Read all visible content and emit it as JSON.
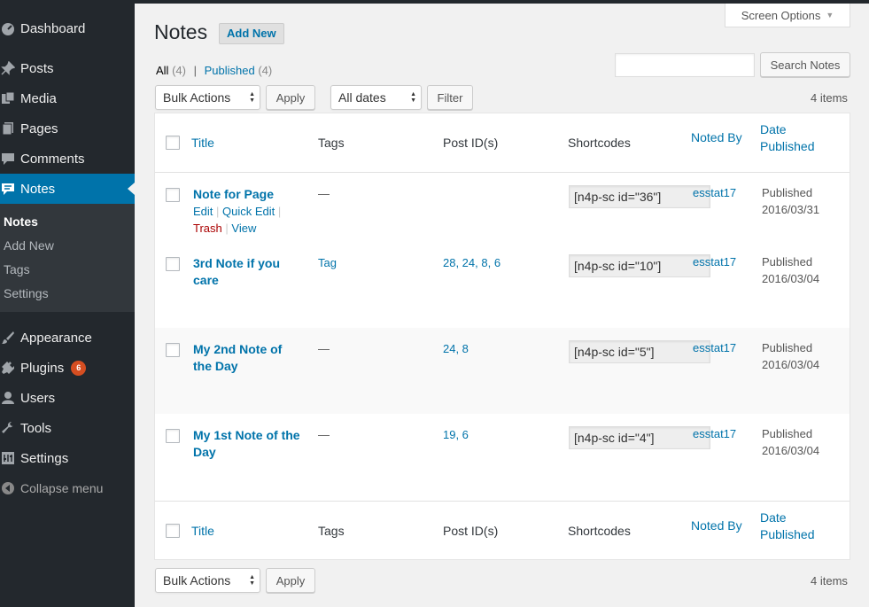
{
  "sidebar": {
    "menu": [
      {
        "label": "Dashboard",
        "icon": "dashboard-icon"
      },
      {
        "label": "Posts",
        "icon": "pin-icon"
      },
      {
        "label": "Media",
        "icon": "media-icon"
      },
      {
        "label": "Pages",
        "icon": "pages-icon"
      },
      {
        "label": "Comments",
        "icon": "comment-icon"
      },
      {
        "label": "Notes",
        "icon": "notes-icon"
      },
      {
        "label": "Appearance",
        "icon": "brush-icon"
      },
      {
        "label": "Plugins",
        "icon": "plugin-icon",
        "badge": "6"
      },
      {
        "label": "Users",
        "icon": "user-icon"
      },
      {
        "label": "Tools",
        "icon": "wrench-icon"
      },
      {
        "label": "Settings",
        "icon": "settings-icon"
      }
    ],
    "submenu": [
      "Notes",
      "Add New",
      "Tags",
      "Settings"
    ],
    "collapse_label": "Collapse menu"
  },
  "header": {
    "screen_options": "Screen Options",
    "title": "Notes",
    "add_new": "Add New"
  },
  "filters": {
    "all_label": "All",
    "all_count": "(4)",
    "separator": "|",
    "published_label": "Published",
    "published_count": "(4)"
  },
  "search": {
    "value": "",
    "button": "Search Notes"
  },
  "tablenav_top": {
    "bulk_actions": "Bulk Actions",
    "apply": "Apply",
    "dates": "All dates",
    "filter": "Filter",
    "items": "4 items"
  },
  "tablenav_bottom": {
    "bulk_actions": "Bulk Actions",
    "apply": "Apply",
    "items": "4 items"
  },
  "columns": {
    "title": "Title",
    "tags": "Tags",
    "post_ids": "Post ID(s)",
    "shortcodes": "Shortcodes",
    "noted_by": "Noted By",
    "date_1": "Date",
    "date_2": "Published"
  },
  "row_actions": {
    "edit": "Edit",
    "quick_edit": "Quick Edit",
    "trash": "Trash",
    "view": "View",
    "sep": "|"
  },
  "rows": [
    {
      "title": "Note for Page",
      "tags": "—",
      "post_ids": "",
      "shortcode": "[n4p-sc id=\"36\"]",
      "author": "esstat17",
      "status": "Published",
      "date": "2016/03/31"
    },
    {
      "title": "3rd Note if you care",
      "tags": "Tag",
      "post_ids": "28, 24, 8, 6",
      "shortcode": "[n4p-sc id=\"10\"]",
      "author": "esstat17",
      "status": "Published",
      "date": "2016/03/04"
    },
    {
      "title": "My 2nd Note of the Day",
      "tags": "—",
      "post_ids": "24, 8",
      "shortcode": "[n4p-sc id=\"5\"]",
      "author": "esstat17",
      "status": "Published",
      "date": "2016/03/04"
    },
    {
      "title": "My 1st Note of the Day",
      "tags": "—",
      "post_ids": "19, 6",
      "shortcode": "[n4p-sc id=\"4\"]",
      "author": "esstat17",
      "status": "Published",
      "date": "2016/03/04"
    }
  ]
}
